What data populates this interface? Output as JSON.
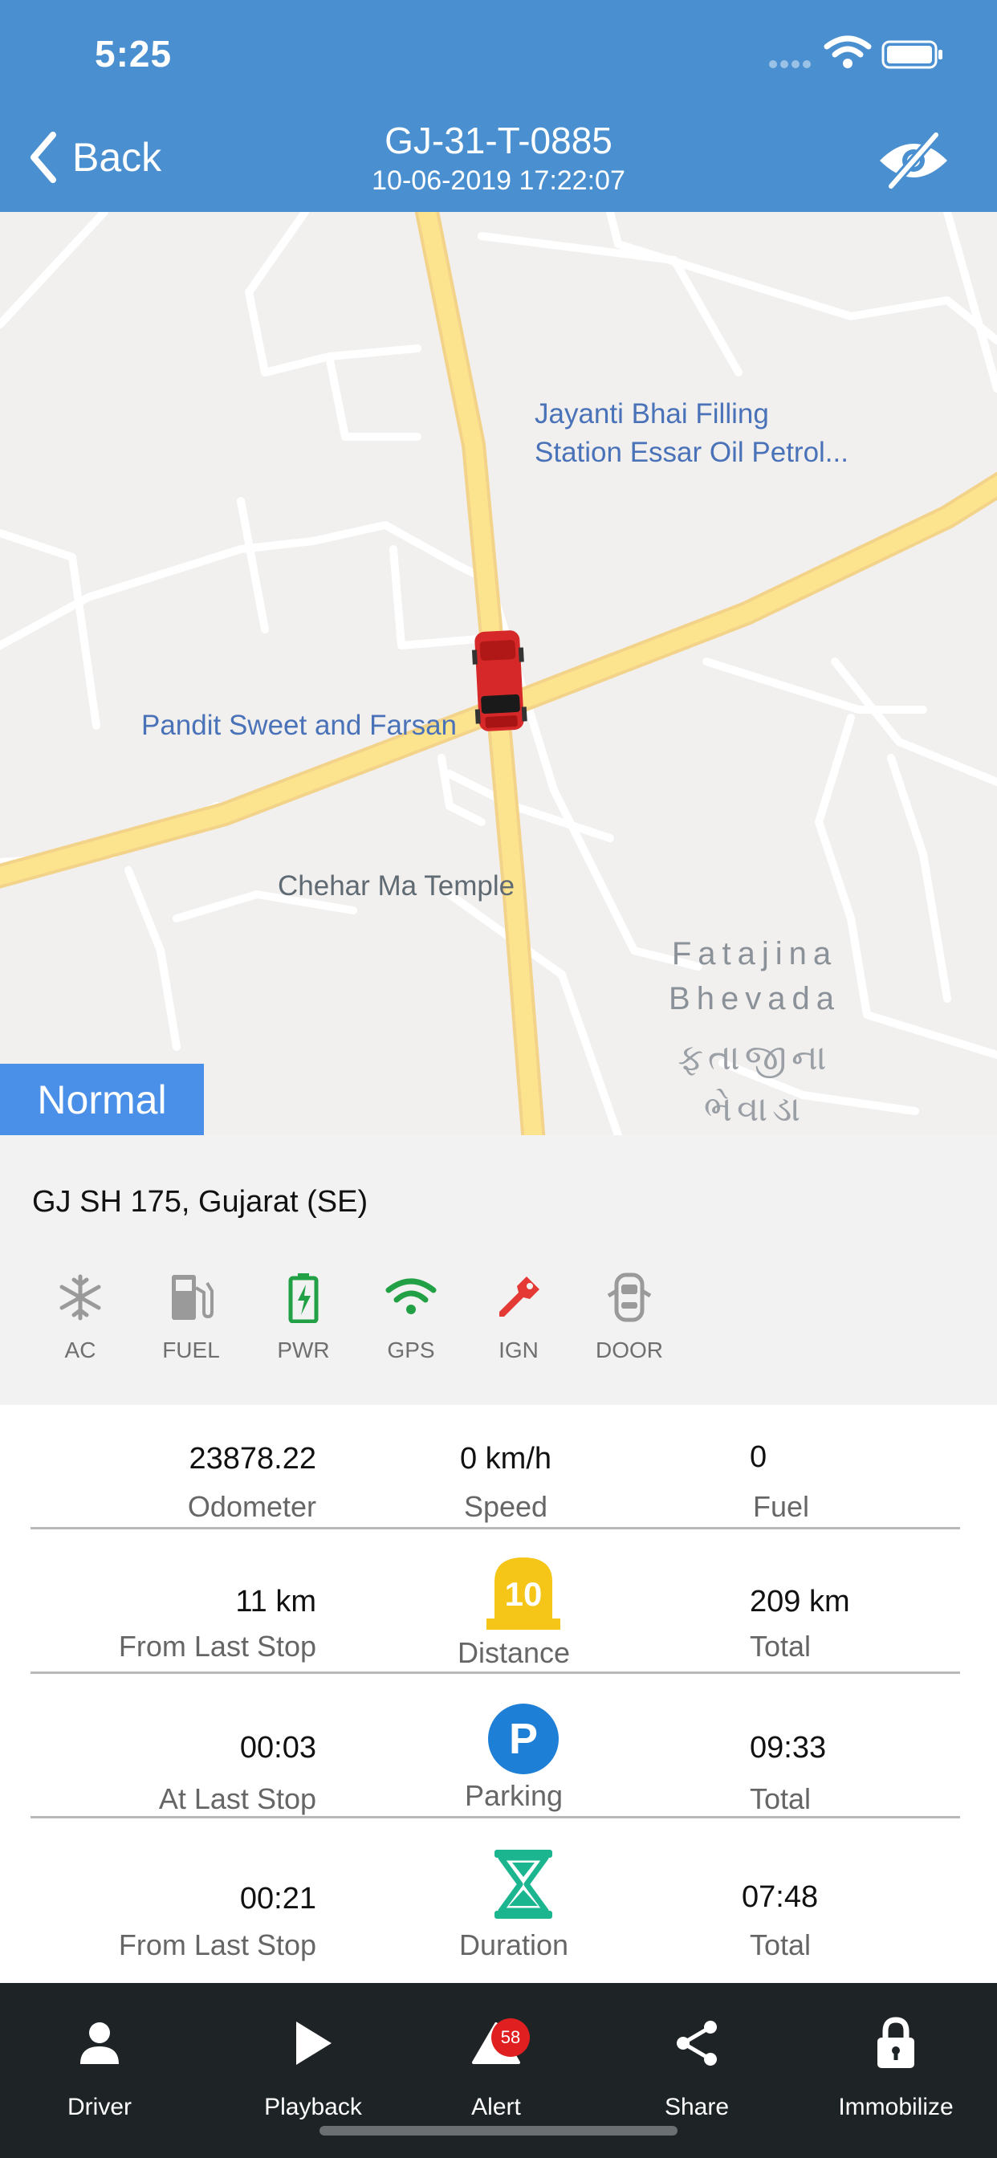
{
  "status_bar": {
    "time": "5:25"
  },
  "header": {
    "back_label": "Back",
    "vehicle_id": "GJ-31-T-0885",
    "datetime": "10-06-2019 17:22:07"
  },
  "map": {
    "labels": {
      "filling_station": "Jayanti Bhai Filling\nStation Essar Oil Petrol...",
      "sweet_shop": "Pandit Sweet and Farsan",
      "temple": "Chehar Ma Temple",
      "village_en": "Fatajina\nBhevada",
      "village_gu": "ફતાજીના\nભેવાડા"
    },
    "status_mode": "Normal"
  },
  "address": "GJ SH 175, Gujarat (SE)",
  "sensors": [
    {
      "label": "AC",
      "icon": "snowflake-icon",
      "color": "#9a9a9a"
    },
    {
      "label": "FUEL",
      "icon": "fuel-pump-icon",
      "color": "#9a9a9a"
    },
    {
      "label": "PWR",
      "icon": "battery-icon",
      "color": "#22a046"
    },
    {
      "label": "GPS",
      "icon": "wifi-signal-icon",
      "color": "#22a046"
    },
    {
      "label": "IGN",
      "icon": "key-icon",
      "color": "#e53935"
    },
    {
      "label": "DOOR",
      "icon": "car-door-icon",
      "color": "#9a9a9a"
    }
  ],
  "stats": {
    "odometer": {
      "value": "23878.22",
      "label": "Odometer"
    },
    "speed": {
      "value": "0 km/h",
      "label": "Speed"
    },
    "fuel": {
      "value": "0",
      "label": "Fuel"
    },
    "distance": {
      "last_value": "11 km",
      "last_label": "From Last Stop",
      "badge": "10",
      "center_label": "Distance",
      "total_value": "209 km",
      "total_label": "Total"
    },
    "parking": {
      "last_value": "00:03",
      "last_label": "At Last Stop",
      "badge": "P",
      "center_label": "Parking",
      "total_value": "09:33",
      "total_label": "Total"
    },
    "duration": {
      "last_value": "00:21",
      "last_label": "From Last Stop",
      "center_label": "Duration",
      "total_value": "07:48",
      "total_label": "Total"
    }
  },
  "colors": {
    "header": "#4a90d0",
    "accent_yellow": "#f5c518",
    "parking_blue": "#1e7fd6",
    "hourglass_teal": "#1bb58f"
  },
  "bottom_nav": [
    {
      "label": "Driver",
      "icon": "driver-icon"
    },
    {
      "label": "Playback",
      "icon": "play-icon"
    },
    {
      "label": "Alert",
      "icon": "alert-icon",
      "badge": "58"
    },
    {
      "label": "Share",
      "icon": "share-icon"
    },
    {
      "label": "Immobilize",
      "icon": "lock-icon"
    }
  ]
}
